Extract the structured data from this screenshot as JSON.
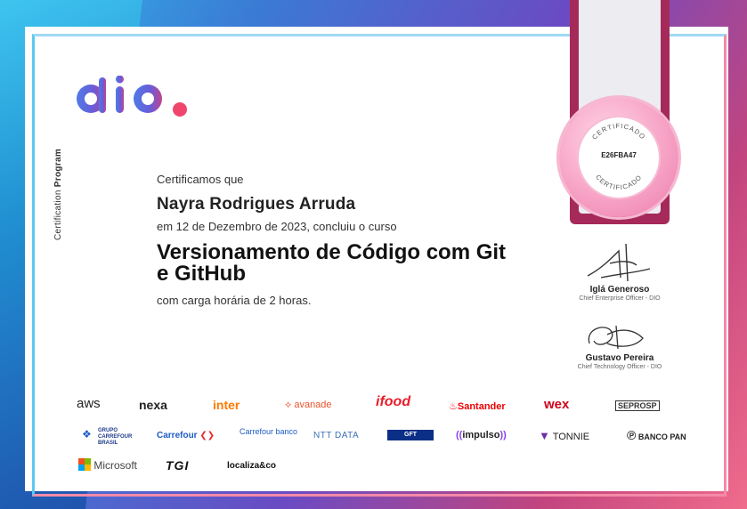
{
  "certificate": {
    "certify_line": "Certificamos que",
    "student_name": "Nayra Rodrigues Arruda",
    "date_line": "em 12 de Dezembro de 2023, concluiu o curso",
    "course_line1": "Versionamento de Código com Git",
    "course_line2": "e GitHub",
    "hours_line": "com carga horária de 2 horas.",
    "side_label_a": "Certification",
    "side_label_b": "Program"
  },
  "seal": {
    "top_text": "CERTIFICADO",
    "bottom_text": "CERTIFICADO",
    "code": "E26FBA47"
  },
  "signatures": [
    {
      "name": "Iglá Generoso",
      "role": "Chief Enterprise Officer - DIO"
    },
    {
      "name": "Gustavo Pereira",
      "role": "Chief Technology Officer - DIO"
    }
  ],
  "partners": {
    "row1": [
      "aws",
      "nexa",
      "inter",
      "avanade",
      "ifood",
      "Santander",
      "wex",
      "SEPROSP"
    ],
    "row2": [
      "GRUPO CARREFOUR BRASIL",
      "Carrefour",
      "Carrefour banco",
      "NTT DATA",
      "GFT",
      "impulso",
      "TONNIE",
      "BANCO PAN"
    ],
    "row3": [
      "Microsoft",
      "TGI",
      "localiza&co"
    ]
  },
  "colors": {
    "logo_blue": "#3a5bd9",
    "logo_pink": "#e0457b",
    "seal_pink": "#f7a3c6",
    "ribbon_dark": "#a52a5a",
    "inter_orange": "#ff7a00",
    "ifood_red": "#ea1d2c",
    "santander_red": "#ec0000",
    "wex_red": "#d0021b",
    "carrefour_blue": "#1e5bc6",
    "tonnie_purple": "#6b2fa7"
  }
}
